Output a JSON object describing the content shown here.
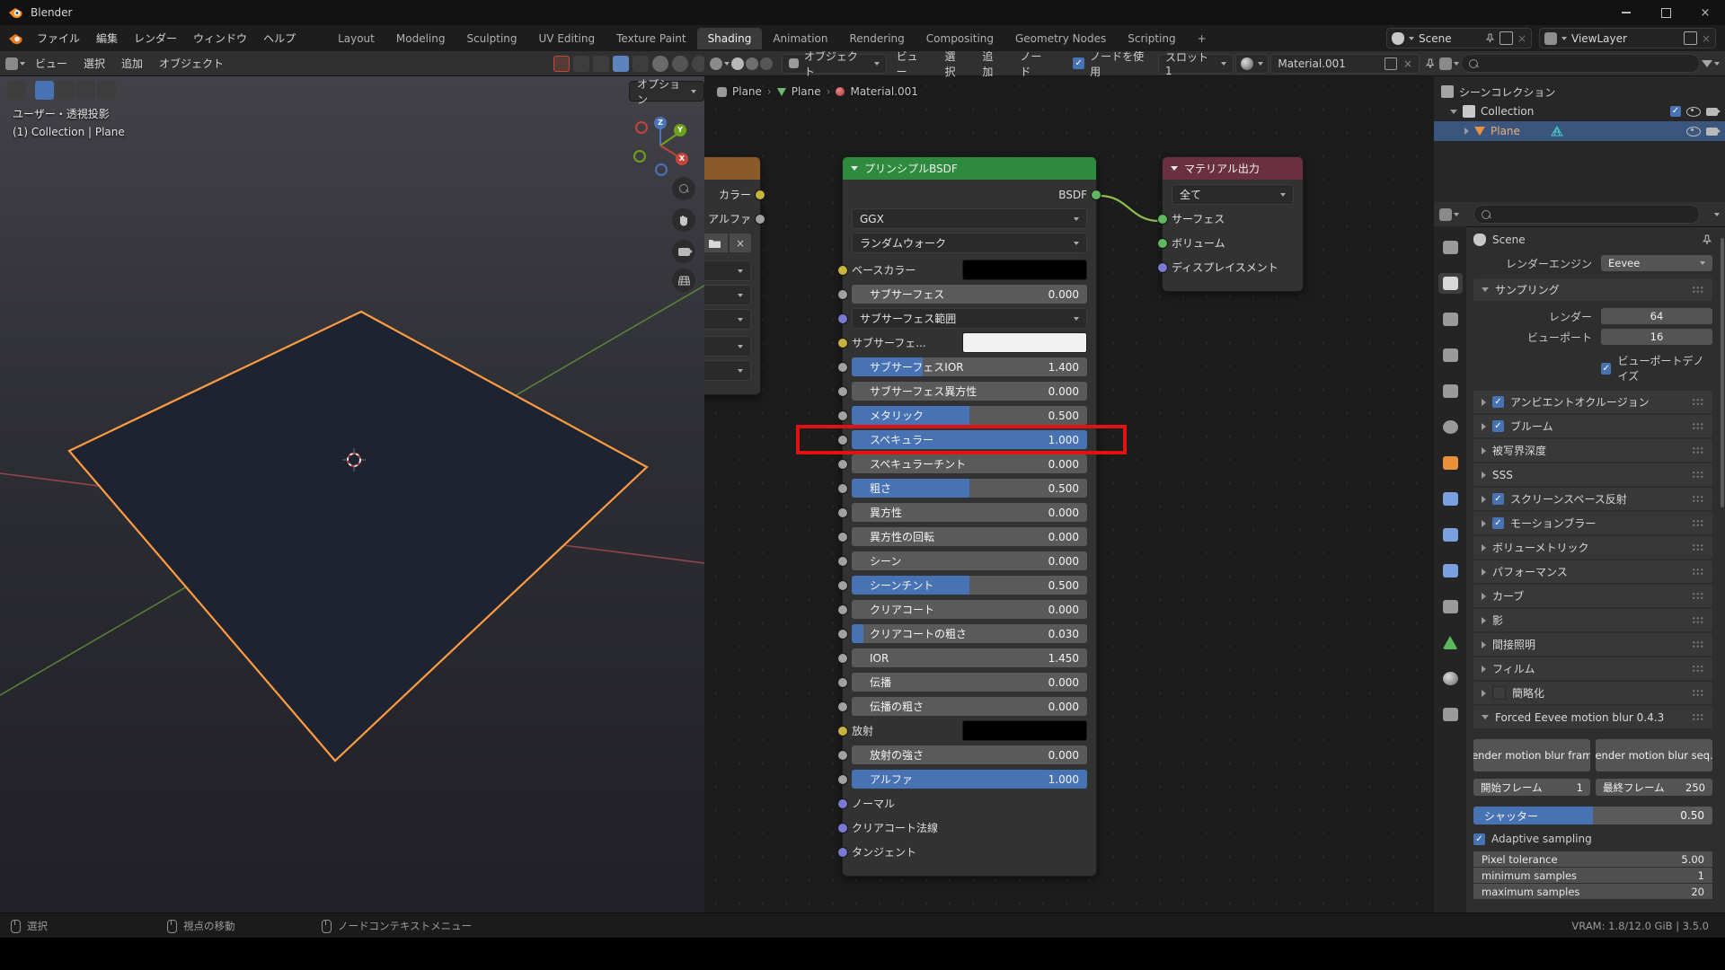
{
  "window": {
    "title": "Blender"
  },
  "topbar": {
    "menus": [
      "ファイル",
      "編集",
      "レンダー",
      "ウィンドウ",
      "ヘルプ"
    ],
    "workspaces": [
      "Layout",
      "Modeling",
      "Sculpting",
      "UV Editing",
      "Texture Paint",
      "Shading",
      "Animation",
      "Rendering",
      "Compositing",
      "Geometry Nodes",
      "Scripting"
    ],
    "active_workspace": "Shading",
    "add_workspace": "+",
    "scene_name": "Scene",
    "viewlayer_name": "ViewLayer"
  },
  "viewport": {
    "menus": [
      "ビュー",
      "選択",
      "追加",
      "オブジェクト"
    ],
    "options_button": "オプション",
    "overlay_view": "ユーザー・透視投影",
    "overlay_context": "(1) Collection | Plane",
    "axis_x": "X",
    "axis_y": "Y",
    "axis_z": "Z",
    "plane_fill": "#1d2330",
    "plane_outline": "#ff9c42"
  },
  "shader": {
    "object_selector": "オブジェクト",
    "menus": [
      "ビュー",
      "選択",
      "追加",
      "ノード"
    ],
    "use_nodes_label": "ノードを使用",
    "slot_label": "スロット1",
    "material_name": "Material.001",
    "breadcrumb": [
      "Plane",
      "Plane",
      "Material.001"
    ],
    "image_node": {
      "outputs": [
        {
          "label": "カラー",
          "socket": "yellow"
        },
        {
          "label": "アルファ",
          "socket": "gray"
        }
      ]
    },
    "principled": {
      "title": "プリンシプルBSDF",
      "output_label": "BSDF",
      "distribution": "GGX",
      "subsurface_method": "ランダムウォーク",
      "rows": [
        {
          "label": "ベースカラー",
          "widget": "color",
          "swatch": "#000000",
          "socket": "yellow"
        },
        {
          "label": "サブサーフェス",
          "widget": "slider",
          "value": "0.000",
          "fill": 0,
          "socket": "gray"
        },
        {
          "label": "サブサーフェス範囲",
          "widget": "dropdown",
          "socket": "vector"
        },
        {
          "label": "サブサーフェ...",
          "widget": "color",
          "swatch": "#f2f2f2",
          "socket": "yellow"
        },
        {
          "label": "サブサーフェスIOR",
          "widget": "slider",
          "value": "1.400",
          "fill": 0.3,
          "socket": "gray"
        },
        {
          "label": "サブサーフェス異方性",
          "widget": "slider",
          "value": "0.000",
          "fill": 0,
          "socket": "gray"
        },
        {
          "label": "メタリック",
          "widget": "slider",
          "value": "0.500",
          "fill": 0.5,
          "socket": "gray"
        },
        {
          "label": "スペキュラー",
          "widget": "slider",
          "value": "1.000",
          "fill": 1,
          "socket": "gray",
          "highlighted": true
        },
        {
          "label": "スペキュラーチント",
          "widget": "slider",
          "value": "0.000",
          "fill": 0,
          "socket": "gray"
        },
        {
          "label": "粗さ",
          "widget": "slider",
          "value": "0.500",
          "fill": 0.5,
          "socket": "gray"
        },
        {
          "label": "異方性",
          "widget": "slider",
          "value": "0.000",
          "fill": 0,
          "socket": "gray"
        },
        {
          "label": "異方性の回転",
          "widget": "slider",
          "value": "0.000",
          "fill": 0,
          "socket": "gray"
        },
        {
          "label": "シーン",
          "widget": "slider",
          "value": "0.000",
          "fill": 0,
          "socket": "gray"
        },
        {
          "label": "シーンチント",
          "widget": "slider",
          "value": "0.500",
          "fill": 0.5,
          "socket": "gray"
        },
        {
          "label": "クリアコート",
          "widget": "slider",
          "value": "0.000",
          "fill": 0,
          "socket": "gray"
        },
        {
          "label": "クリアコートの粗さ",
          "widget": "slider",
          "value": "0.030",
          "fill": 0.05,
          "socket": "gray"
        },
        {
          "label": "IOR",
          "widget": "slider",
          "value": "1.450",
          "fill": 0,
          "socket": "gray"
        },
        {
          "label": "伝播",
          "widget": "slider",
          "value": "0.000",
          "fill": 0,
          "socket": "gray"
        },
        {
          "label": "伝播の粗さ",
          "widget": "slider",
          "value": "0.000",
          "fill": 0,
          "socket": "gray"
        },
        {
          "label": "放射",
          "widget": "color",
          "swatch": "#000000",
          "socket": "yellow"
        },
        {
          "label": "放射の強さ",
          "widget": "slider",
          "value": "0.000",
          "fill": 0,
          "socket": "gray"
        },
        {
          "label": "アルファ",
          "widget": "slider",
          "value": "1.000",
          "fill": 1,
          "socket": "gray"
        },
        {
          "label": "ノーマル",
          "widget": "none",
          "socket": "vector"
        },
        {
          "label": "クリアコート法線",
          "widget": "none",
          "socket": "vector"
        },
        {
          "label": "タンジェント",
          "widget": "none",
          "socket": "vector"
        }
      ]
    },
    "output_node": {
      "title": "マテリアル出力",
      "target": "全て",
      "inputs": [
        {
          "label": "サーフェス",
          "socket": "green"
        },
        {
          "label": "ボリューム",
          "socket": "green"
        },
        {
          "label": "ディスプレイスメント",
          "socket": "vector"
        }
      ]
    },
    "highlight_color": "#e01212"
  },
  "outliner": {
    "scene_collection": "シーンコレクション",
    "collection": "Collection",
    "object": "Plane"
  },
  "properties": {
    "tabs": [
      "tool",
      "render",
      "output",
      "view-layer",
      "scene",
      "world",
      "object",
      "modifiers",
      "particles",
      "physics",
      "constraints",
      "object-data",
      "material",
      "texture"
    ],
    "active_tab": "render",
    "nav_label": "Scene",
    "engine_label": "レンダーエンジン",
    "engine_value": "Eevee",
    "sampling": {
      "title": "サンプリング",
      "rows": [
        {
          "label": "レンダー",
          "value": "64"
        },
        {
          "label": "ビューポート",
          "value": "16"
        }
      ],
      "denoise_label": "ビューポートデノイズ",
      "denoise_checked": true
    },
    "sections": [
      {
        "label": "アンビエントオクルージョン",
        "checkbox": true,
        "checked": true
      },
      {
        "label": "ブルーム",
        "checkbox": true,
        "checked": true
      },
      {
        "label": "被写界深度"
      },
      {
        "label": "SSS"
      },
      {
        "label": "スクリーンスペース反射",
        "checkbox": true,
        "checked": true
      },
      {
        "label": "モーションブラー",
        "checkbox": true,
        "checked": true
      },
      {
        "label": "ボリューメトリック"
      },
      {
        "label": "パフォーマンス"
      },
      {
        "label": "カーブ"
      },
      {
        "label": "影"
      },
      {
        "label": "間接照明"
      },
      {
        "label": "フィルム"
      },
      {
        "label": "簡略化",
        "checkbox": true,
        "checked": false
      }
    ],
    "motion_blur": {
      "title": "Forced Eevee motion blur 0.4.3",
      "buttons": [
        "Render motion blur frame",
        "Render motion blur seq..."
      ],
      "frame_fields": [
        {
          "label": "開始フレーム",
          "value": "1"
        },
        {
          "label": "最終フレーム",
          "value": "250"
        }
      ],
      "shutter": {
        "label": "シャッター",
        "value": "0.50",
        "fill": 0.5
      },
      "adaptive_label": "Adaptive sampling",
      "adaptive_checked": true,
      "value_rows": [
        {
          "label": "Pixel tolerance",
          "value": "5.00"
        },
        {
          "label": "minimum samples",
          "value": "1"
        },
        {
          "label": "maximum samples",
          "value": "20"
        }
      ]
    }
  },
  "statusbar": {
    "items": [
      "選択",
      "視点の移動",
      "ノードコンテキストメニュー"
    ],
    "vram": "VRAM: 1.8/12.0 GiB | 3.5.0"
  }
}
